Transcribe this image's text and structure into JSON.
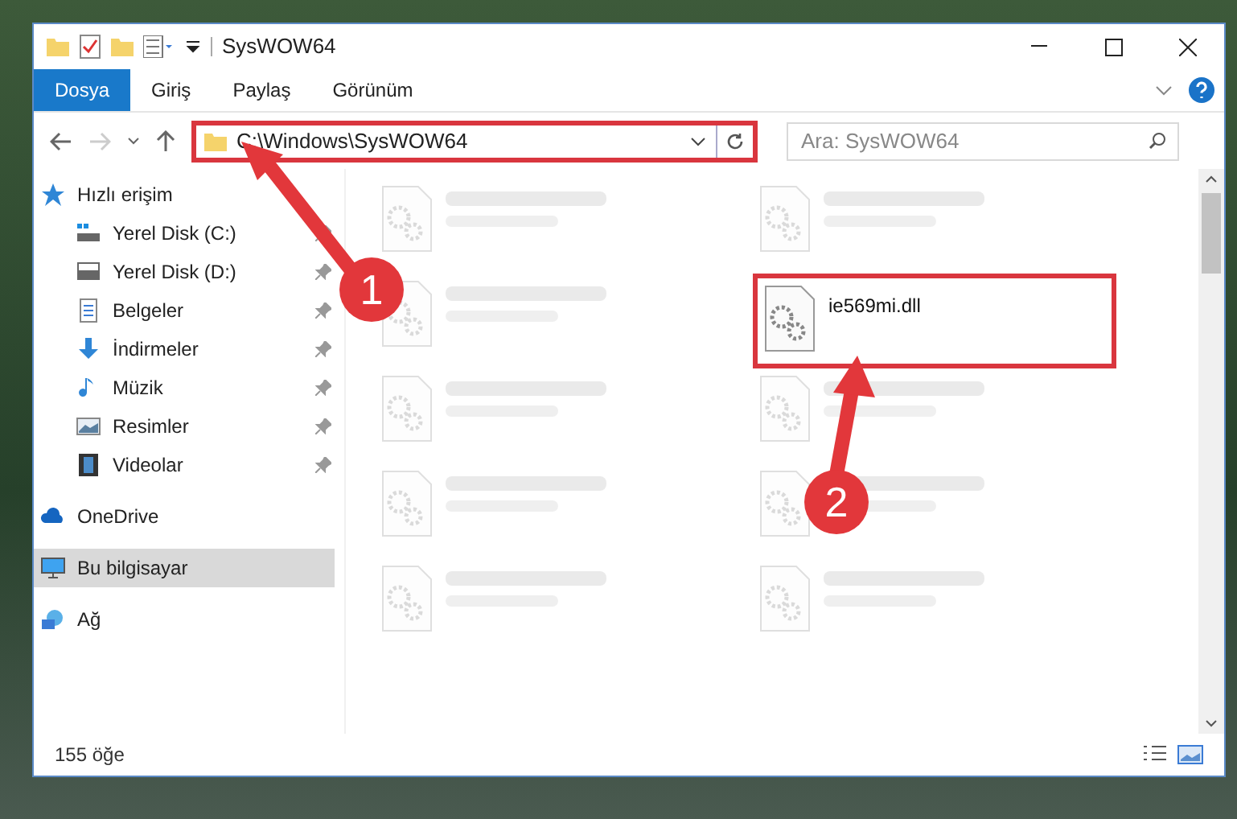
{
  "window": {
    "title": "SysWOW64"
  },
  "ribbon_tabs": [
    {
      "label": "Dosya",
      "selected": true
    },
    {
      "label": "Giriş",
      "selected": false
    },
    {
      "label": "Paylaş",
      "selected": false
    },
    {
      "label": "Görünüm",
      "selected": false
    }
  ],
  "address": {
    "path": "C:\\Windows\\SysWOW64",
    "highlighted": true
  },
  "search": {
    "placeholder": "Ara: SysWOW64"
  },
  "sidebar": {
    "items": [
      {
        "label": "Hızlı erişim",
        "kind": "star",
        "selected": false,
        "pinned": false,
        "children": [
          {
            "label": "Yerel Disk (C:)",
            "kind": "drive-c",
            "selected": false,
            "pinned": true
          },
          {
            "label": "Yerel Disk (D:)",
            "kind": "drive",
            "selected": false,
            "pinned": true
          },
          {
            "label": "Belgeler",
            "kind": "docs",
            "selected": false,
            "pinned": true
          },
          {
            "label": "İndirmeler",
            "kind": "download",
            "selected": false,
            "pinned": true
          },
          {
            "label": "Müzik",
            "kind": "music",
            "selected": false,
            "pinned": true
          },
          {
            "label": "Resimler",
            "kind": "pictures",
            "selected": false,
            "pinned": true
          },
          {
            "label": "Videolar",
            "kind": "videos",
            "selected": false,
            "pinned": true
          }
        ]
      },
      {
        "label": "OneDrive",
        "kind": "cloud",
        "selected": false,
        "pinned": false
      },
      {
        "label": "Bu bilgisayar",
        "kind": "pc",
        "selected": true,
        "pinned": false
      },
      {
        "label": "Ağ",
        "kind": "network",
        "selected": false,
        "pinned": false
      }
    ]
  },
  "files": [
    {
      "blurred": true,
      "highlighted": false
    },
    {
      "blurred": true,
      "highlighted": false
    },
    {
      "blurred": true,
      "highlighted": false
    },
    {
      "name": "ie569mi.dll",
      "blurred": false,
      "highlighted": true
    },
    {
      "blurred": true,
      "highlighted": false
    },
    {
      "blurred": true,
      "highlighted": false
    },
    {
      "blurred": true,
      "highlighted": false
    },
    {
      "blurred": true,
      "highlighted": false
    },
    {
      "blurred": true,
      "highlighted": false
    },
    {
      "blurred": true,
      "highlighted": false
    }
  ],
  "status_bar": {
    "count": "155 öğe"
  },
  "annotations": [
    {
      "number": "1"
    },
    {
      "number": "2"
    }
  ]
}
